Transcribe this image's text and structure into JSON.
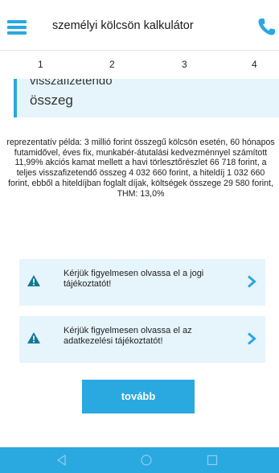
{
  "header": {
    "title": "személyi kölcsön kalkulátor",
    "menu_icon": "hamburger-menu-icon",
    "phone_icon": "phone-icon",
    "accent_color": "#2aa8e0"
  },
  "steps": [
    "1",
    "2",
    "3",
    "4"
  ],
  "amount_field": {
    "label_cut": "visszafizetendő",
    "label": "összeg"
  },
  "representative_example": "reprezentatív példa: 3 millió forint összegű kölcsön esetén, 60 hónapos futamidővel, éves fix, munkabér-átutalási kedvezménnyel számított 11,99% akciós kamat mellett a havi törlesztőrészlet 66 718 forint, a teljes visszafizetendő összeg 4 032 660 forint, a hiteldíj 1 032 660 forint, ebből a hiteldíjban foglalt díjak, költségek összege 29 580 forint, THM: 13,0%",
  "notices": [
    {
      "text": "Kérjük figyelmesen olvassa el a jogi tájékoztatót!",
      "icon": "warning-icon"
    },
    {
      "text": "Kérjük figyelmesen olvassa el az adatkezelési tájékoztatót!",
      "icon": "warning-icon"
    }
  ],
  "next_button": {
    "label": "tovább"
  },
  "system_nav": {
    "back_icon": "back-icon",
    "home_icon": "home-icon",
    "recent_icon": "recent-apps-icon"
  }
}
